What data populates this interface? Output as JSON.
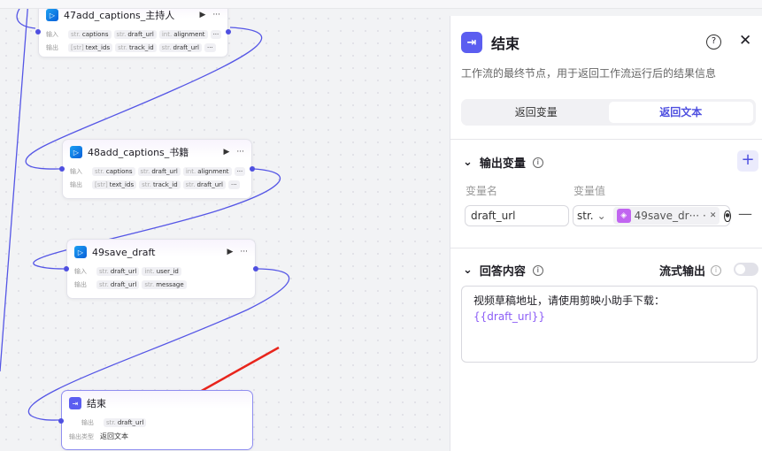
{
  "canvas": {
    "nodes": [
      {
        "title": "47add_captions_主持人",
        "in_label": "输入",
        "out_label": "输出",
        "inputs": [
          [
            "str.",
            "captions"
          ],
          [
            "str.",
            "draft_url"
          ],
          [
            "int.",
            "alignment"
          ]
        ],
        "outputs": [
          [
            "[str]",
            "text_ids"
          ],
          [
            "str.",
            "track_id"
          ],
          [
            "str.",
            "draft_url"
          ]
        ]
      },
      {
        "title": "48add_captions_书籍",
        "in_label": "输入",
        "out_label": "输出",
        "inputs": [
          [
            "str.",
            "captions"
          ],
          [
            "str.",
            "draft_url"
          ],
          [
            "int.",
            "alignment"
          ]
        ],
        "outputs": [
          [
            "[str]",
            "text_ids"
          ],
          [
            "str.",
            "track_id"
          ],
          [
            "str.",
            "draft_url"
          ]
        ]
      },
      {
        "title": "49save_draft",
        "in_label": "输入",
        "out_label": "输出",
        "inputs": [
          [
            "str.",
            "draft_url"
          ],
          [
            "int.",
            "user_id"
          ]
        ],
        "outputs": [
          [
            "str.",
            "draft_url"
          ],
          [
            "str.",
            "message"
          ]
        ]
      }
    ],
    "end_node": {
      "title": "结束",
      "out_label": "输出",
      "out_tag": [
        "str.",
        "draft_url"
      ],
      "type_label": "输出类型",
      "type_value": "返回文本"
    },
    "more": "···"
  },
  "panel": {
    "title": "结束",
    "description": "工作流的最终节点，用于返回工作流运行后的结果信息",
    "tabs": [
      "返回变量",
      "返回文本"
    ],
    "output_section": "输出变量",
    "col_name": "变量名",
    "col_value": "变量值",
    "var_name": "draft_url",
    "var_type": "str.",
    "var_ref": "49save_dr···",
    "var_ref_suffix": "·",
    "answer_section": "回答内容",
    "stream_label": "流式输出",
    "answer_text": "视频草稿地址，请使用剪映小助手下载：",
    "answer_var": "{{draft_url}}"
  },
  "colors": {
    "accent": "#4e4fe0",
    "edge": "#5556e6",
    "arrow": "#e8251c"
  }
}
